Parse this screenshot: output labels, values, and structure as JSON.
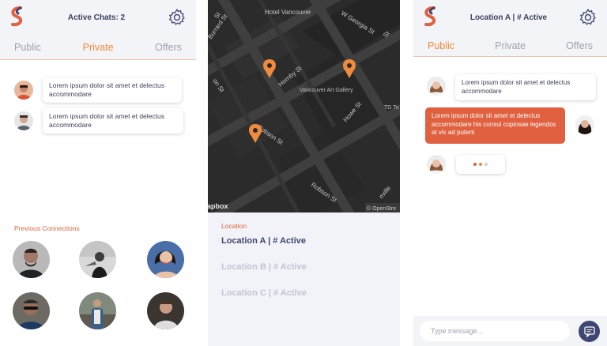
{
  "left": {
    "header_title": "Active Chats: 2",
    "tabs": [
      {
        "label": "Public",
        "active": false
      },
      {
        "label": "Private",
        "active": true
      },
      {
        "label": "Offers",
        "active": false
      }
    ],
    "chats": [
      {
        "text": "Lorem ipsum dolor sit amet et delectus accommodare"
      },
      {
        "text": "Lorem ipsum dolor sit amet et delectus accommodare"
      }
    ],
    "previous_connections_label": "Previous Connections"
  },
  "map": {
    "labels": {
      "hotel": "Hotel Vancouver",
      "gallery": "Vancouver Art Gallery",
      "w_georgia": "W Georgia St",
      "hornby": "Hornby St",
      "howe": "Howe St",
      "robson_1": "Robson St",
      "robson_2": "Robson St",
      "burrard": "Burrard St",
      "st_tl": "St",
      "td": "TD To",
      "st_ml": "on St",
      "st_sm": "St",
      "granville": "nville",
      "brand": "apbox",
      "attribution": "© OpenStre"
    },
    "location_label": "Location",
    "locations": [
      {
        "label": "Location A | # Active",
        "active": true
      },
      {
        "label": "Location B | # Active",
        "active": false
      },
      {
        "label": "Location C | # Active",
        "active": false
      }
    ]
  },
  "right": {
    "header_title": "Location A | # Active",
    "tabs": [
      {
        "label": "Public",
        "active": true
      },
      {
        "label": "Private",
        "active": false
      },
      {
        "label": "Offers",
        "active": false
      }
    ],
    "messages": [
      {
        "text": "Lorem ipsum dolor sit amet et delectus accommodare",
        "outgoing": false
      },
      {
        "text": "Lorem ipsum dolor sit amet et delectus accommodare his consul copiosae legendos at vix ad putent",
        "outgoing": true
      }
    ],
    "composer_placeholder": "Type message..."
  },
  "colors": {
    "accent": "#f08a3c",
    "accent_red": "#e0623a",
    "bubble_out": "#e0603f",
    "navy": "#3f4670",
    "map_bg": "#2a2a2a"
  }
}
